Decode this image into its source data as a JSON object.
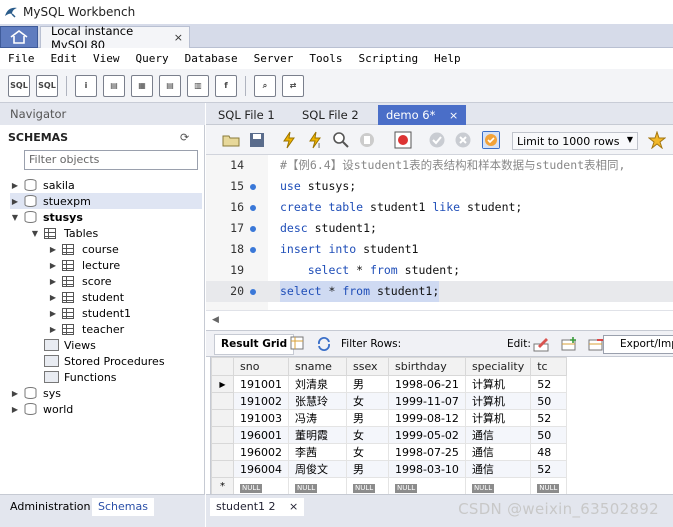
{
  "window": {
    "title": "MySQL Workbench"
  },
  "connection_tab": {
    "label": "Local instance MySQL80",
    "close": "×"
  },
  "menu": [
    "File",
    "Edit",
    "View",
    "Query",
    "Database",
    "Server",
    "Tools",
    "Scripting",
    "Help"
  ],
  "navigator": {
    "header": "Navigator",
    "schemas_label": "SCHEMAS",
    "filter_placeholder": "Filter objects",
    "tree": {
      "sakila": "sakila",
      "stuexpm": "stuexpm",
      "stusys": "stusys",
      "tables": "Tables",
      "t_course": "course",
      "t_lecture": "lecture",
      "t_score": "score",
      "t_student": "student",
      "t_student1": "student1",
      "t_teacher": "teacher",
      "views": "Views",
      "procs": "Stored Procedures",
      "funcs": "Functions",
      "sys": "sys",
      "world": "world"
    },
    "bottom_tabs": {
      "admin": "Administration",
      "schemas": "Schemas"
    }
  },
  "editor_tabs": [
    {
      "label": "SQL File 1"
    },
    {
      "label": "SQL File 2"
    },
    {
      "label": "demo 6*",
      "close": "×"
    }
  ],
  "sql_toolbar": {
    "limit": "Limit to 1000 rows"
  },
  "editor": {
    "lines": [
      {
        "n": "14",
        "parts": [
          {
            "t": "#【例6.4】设student1表的表结构和样本数据与student表相同,",
            "c": "cm"
          }
        ]
      },
      {
        "n": "15",
        "parts": [
          {
            "t": "use",
            "c": "kw"
          },
          {
            "t": " stusys;",
            "c": ""
          }
        ]
      },
      {
        "n": "16",
        "parts": [
          {
            "t": "create table",
            "c": "kw"
          },
          {
            "t": " student1 ",
            "c": ""
          },
          {
            "t": "like",
            "c": "kw"
          },
          {
            "t": " student;",
            "c": ""
          }
        ]
      },
      {
        "n": "17",
        "parts": [
          {
            "t": "desc",
            "c": "kw"
          },
          {
            "t": " student1;",
            "c": ""
          }
        ]
      },
      {
        "n": "18",
        "parts": [
          {
            "t": "insert into",
            "c": "kw"
          },
          {
            "t": " student1",
            "c": ""
          }
        ]
      },
      {
        "n": "19",
        "parts": [
          {
            "t": "    select",
            "c": "kw"
          },
          {
            "t": " * ",
            "c": ""
          },
          {
            "t": "from",
            "c": "kw"
          },
          {
            "t": " student;",
            "c": ""
          }
        ]
      },
      {
        "n": "20",
        "parts": [
          {
            "t": "select",
            "c": "kw"
          },
          {
            "t": " * ",
            "c": ""
          },
          {
            "t": "from",
            "c": "kw"
          },
          {
            "t": " student1;",
            "c": ""
          }
        ]
      }
    ]
  },
  "result_bar": {
    "grid_tab": "Result Grid",
    "filter_rows": "Filter Rows:",
    "edit": "Edit:",
    "export": "Export/Impo"
  },
  "result_grid": {
    "columns": [
      "sno",
      "sname",
      "ssex",
      "sbirthday",
      "speciality",
      "tc"
    ],
    "rows": [
      [
        "191001",
        "刘清泉",
        "男",
        "1998-06-21",
        "计算机",
        "52"
      ],
      [
        "191002",
        "张慧玲",
        "女",
        "1999-11-07",
        "计算机",
        "50"
      ],
      [
        "191003",
        "冯涛",
        "男",
        "1999-08-12",
        "计算机",
        "52"
      ],
      [
        "196001",
        "董明霞",
        "女",
        "1999-05-02",
        "通信",
        "50"
      ],
      [
        "196002",
        "李茜",
        "女",
        "1998-07-25",
        "通信",
        "48"
      ],
      [
        "196004",
        "周俊文",
        "男",
        "1998-03-10",
        "通信",
        "52"
      ]
    ],
    "null_label": "NULL",
    "new_row_marker": "*"
  },
  "result_tabs": [
    {
      "label": "student1 2",
      "close": "×"
    }
  ],
  "watermark": "CSDN @weixin_63502892",
  "colors": {
    "accent": "#4a6ec8",
    "keyword": "#1f4eb8",
    "dot": "#3a78d8"
  }
}
